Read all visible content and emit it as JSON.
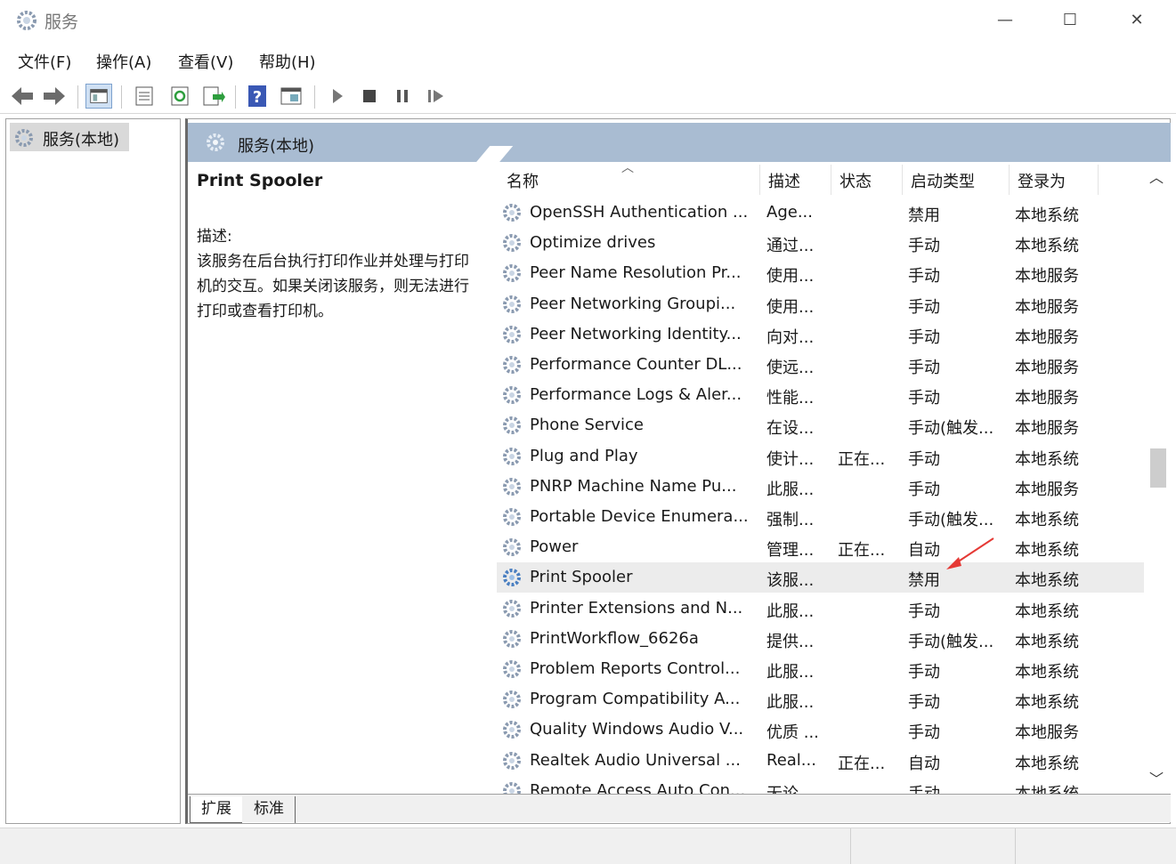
{
  "window": {
    "title": "服务",
    "minimize_glyph": "—",
    "maximize_glyph": "☐",
    "close_glyph": "✕"
  },
  "menu": [
    {
      "label": "文件(F)"
    },
    {
      "label": "操作(A)"
    },
    {
      "label": "查看(V)"
    },
    {
      "label": "帮助(H)"
    }
  ],
  "toolbar": {
    "icons": [
      "back-arrow-icon",
      "forward-arrow-icon",
      "show-hide-console-tree-icon",
      "properties-icon",
      "refresh-icon",
      "export-list-icon",
      "help-icon",
      "view-icon",
      "start-service-icon",
      "stop-service-icon",
      "pause-service-icon",
      "resume-service-icon"
    ]
  },
  "tree": {
    "root_label": "服务(本地)"
  },
  "main": {
    "header_title": "服务(本地)",
    "selected_service": {
      "name": "Print Spooler",
      "desc_label": "描述:",
      "desc_text": "该服务在后台执行打印作业并处理与打印机的交互。如果关闭该服务，则无法进行打印或查看打印机。"
    },
    "columns": {
      "name": "名称",
      "desc": "描述",
      "status": "状态",
      "startup": "启动类型",
      "logon": "登录为"
    },
    "rows": [
      {
        "name": "OpenSSH Authentication ...",
        "desc": "Age...",
        "status": "",
        "startup": "禁用",
        "logon": "本地系统"
      },
      {
        "name": "Optimize drives",
        "desc": "通过...",
        "status": "",
        "startup": "手动",
        "logon": "本地系统"
      },
      {
        "name": "Peer Name Resolution Pr...",
        "desc": "使用...",
        "status": "",
        "startup": "手动",
        "logon": "本地服务"
      },
      {
        "name": "Peer Networking Groupi...",
        "desc": "使用...",
        "status": "",
        "startup": "手动",
        "logon": "本地服务"
      },
      {
        "name": "Peer Networking Identity...",
        "desc": "向对...",
        "status": "",
        "startup": "手动",
        "logon": "本地服务"
      },
      {
        "name": "Performance Counter DL...",
        "desc": "使远...",
        "status": "",
        "startup": "手动",
        "logon": "本地服务"
      },
      {
        "name": "Performance Logs & Aler...",
        "desc": "性能...",
        "status": "",
        "startup": "手动",
        "logon": "本地服务"
      },
      {
        "name": "Phone Service",
        "desc": "在设...",
        "status": "",
        "startup": "手动(触发...",
        "logon": "本地服务"
      },
      {
        "name": "Plug and Play",
        "desc": "使计...",
        "status": "正在...",
        "startup": "手动",
        "logon": "本地系统"
      },
      {
        "name": "PNRP Machine Name Pu...",
        "desc": "此服...",
        "status": "",
        "startup": "手动",
        "logon": "本地服务"
      },
      {
        "name": "Portable Device Enumera...",
        "desc": "强制...",
        "status": "",
        "startup": "手动(触发...",
        "logon": "本地系统"
      },
      {
        "name": "Power",
        "desc": "管理...",
        "status": "正在...",
        "startup": "自动",
        "logon": "本地系统"
      },
      {
        "name": "Print Spooler",
        "desc": "该服...",
        "status": "",
        "startup": "禁用",
        "logon": "本地系统",
        "selected": true
      },
      {
        "name": "Printer Extensions and N...",
        "desc": "此服...",
        "status": "",
        "startup": "手动",
        "logon": "本地系统"
      },
      {
        "name": "PrintWorkflow_6626a",
        "desc": "提供...",
        "status": "",
        "startup": "手动(触发...",
        "logon": "本地系统"
      },
      {
        "name": "Problem Reports Control...",
        "desc": "此服...",
        "status": "",
        "startup": "手动",
        "logon": "本地系统"
      },
      {
        "name": "Program Compatibility A...",
        "desc": "此服...",
        "status": "",
        "startup": "手动",
        "logon": "本地系统"
      },
      {
        "name": "Quality Windows Audio V...",
        "desc": "优质 ...",
        "status": "",
        "startup": "手动",
        "logon": "本地服务"
      },
      {
        "name": "Realtek Audio Universal ...",
        "desc": "Real...",
        "status": "正在...",
        "startup": "自动",
        "logon": "本地系统"
      },
      {
        "name": "Remote Access Auto Con...",
        "desc": "无论...",
        "status": "",
        "startup": "手动",
        "logon": "本地系统"
      }
    ],
    "tabs": {
      "extended": "扩展",
      "standard": "标准"
    }
  },
  "colors": {
    "header_band": "#a9bcd2",
    "selected_row": "#ececec",
    "annotation_arrow": "#e53935",
    "gear_blue": "#4a7fc1"
  }
}
